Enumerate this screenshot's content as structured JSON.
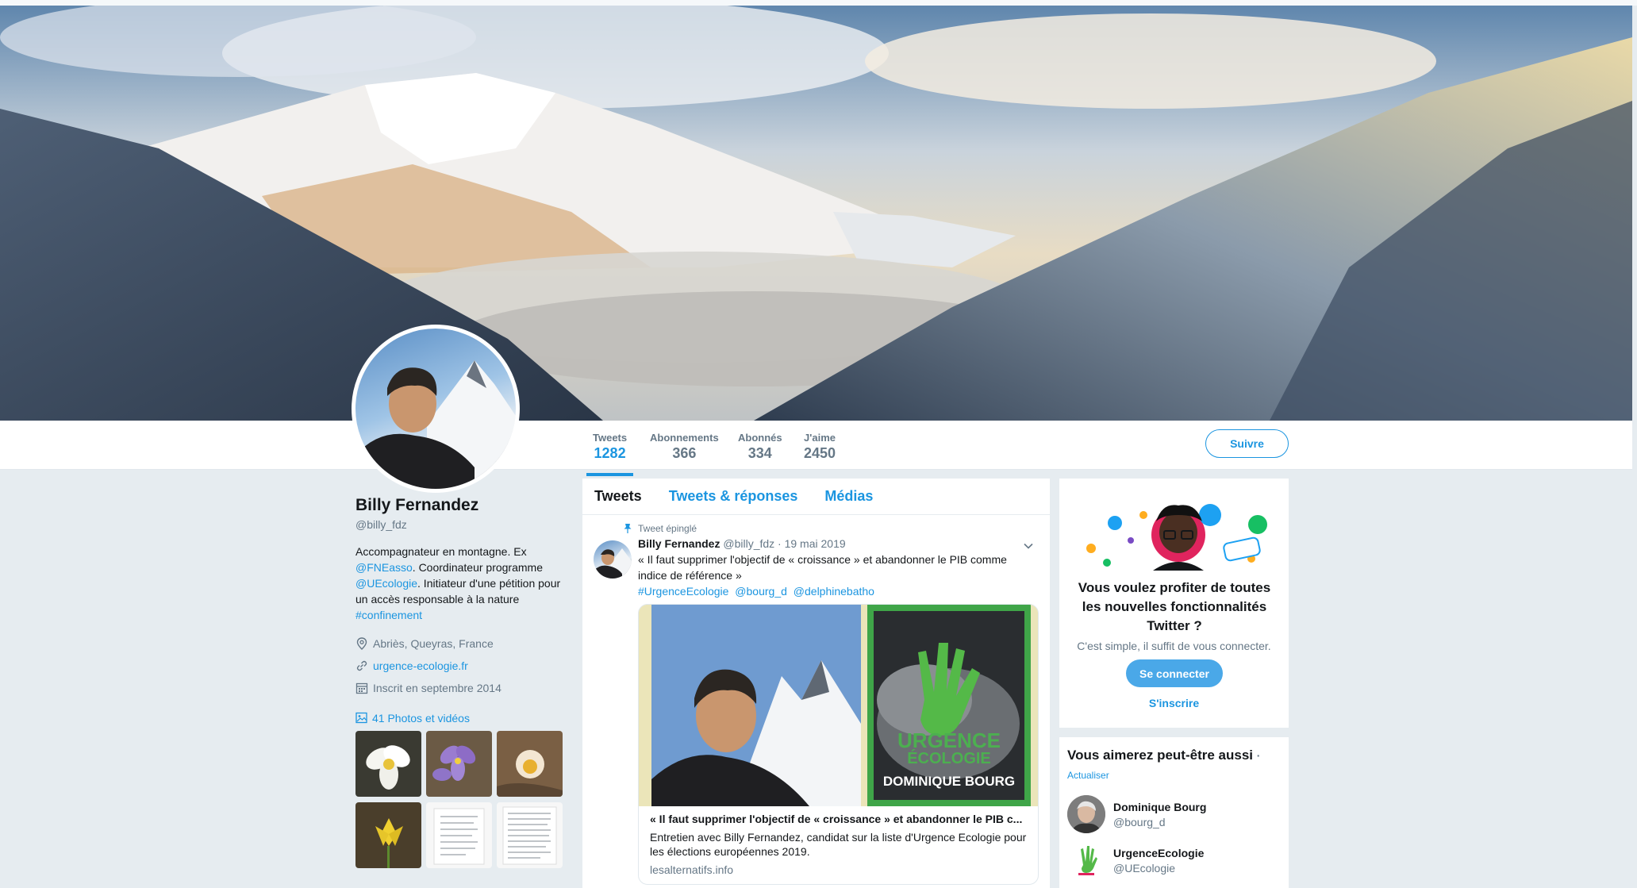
{
  "profile": {
    "name": "Billy Fernandez",
    "handle": "@billy_fdz",
    "bio": {
      "t1": "Accompagnateur en montagne. Ex",
      "m1": "@FNEasso",
      "t2": ". Coordinateur programme",
      "m2": "@UEcologie",
      "t3": ". Initiateur d'une pétition pour un accès responsable à la nature",
      "tag": "#confinement"
    },
    "location": "Abriès, Queyras, France",
    "website": "urgence-ecologie.fr",
    "joined": "Inscrit en septembre 2014",
    "photos_label": "41 Photos et vidéos"
  },
  "stats": [
    {
      "label": "Tweets",
      "value": "1282"
    },
    {
      "label": "Abonnements",
      "value": "366"
    },
    {
      "label": "Abonnés",
      "value": "334"
    },
    {
      "label": "J'aime",
      "value": "2450"
    }
  ],
  "follow_label": "Suivre",
  "timeline": {
    "tabs": [
      "Tweets",
      "Tweets & réponses",
      "Médias"
    ],
    "pinned_label": "Tweet épinglé",
    "tweet": {
      "name": "Billy Fernandez",
      "handle": "@billy_fdz",
      "date": "· 19 mai 2019",
      "text": "« Il faut supprimer l'objectif de « croissance » et abandonner le PIB comme indice de référence »",
      "tags": [
        "#UrgenceEcologie",
        "@bourg_d",
        "@delphinebatho"
      ],
      "card": {
        "title": "« Il faut supprimer l'objectif de « croissance » et abandonner le PIB c...",
        "description": "Entretien avec Billy Fernandez, candidat sur la liste d'Urgence Ecologie pour les élections européennes 2019.",
        "url": "lesalternatifs.info",
        "poster_line1": "URGENCE",
        "poster_line2": "ÉCOLOGIE",
        "poster_name": "DOMINIQUE BOURG"
      }
    }
  },
  "signup": {
    "title": "Vous voulez profiter de toutes les nouvelles fonctionnalités Twitter ?",
    "subtitle": "C'est simple, il suffit de vous connecter.",
    "connect_label": "Se connecter",
    "register_label": "S'inscrire"
  },
  "who_to_follow": {
    "title": "Vous aimerez peut-être aussi",
    "dot": "·",
    "refresh": "Actualiser",
    "users": [
      {
        "name": "Dominique Bourg",
        "handle": "@bourg_d"
      },
      {
        "name": "UrgenceEcologie",
        "handle": "@UEcologie"
      }
    ]
  },
  "colors": {
    "accent": "#1b95e0",
    "muted": "#657786",
    "background": "#e6ecf0"
  }
}
